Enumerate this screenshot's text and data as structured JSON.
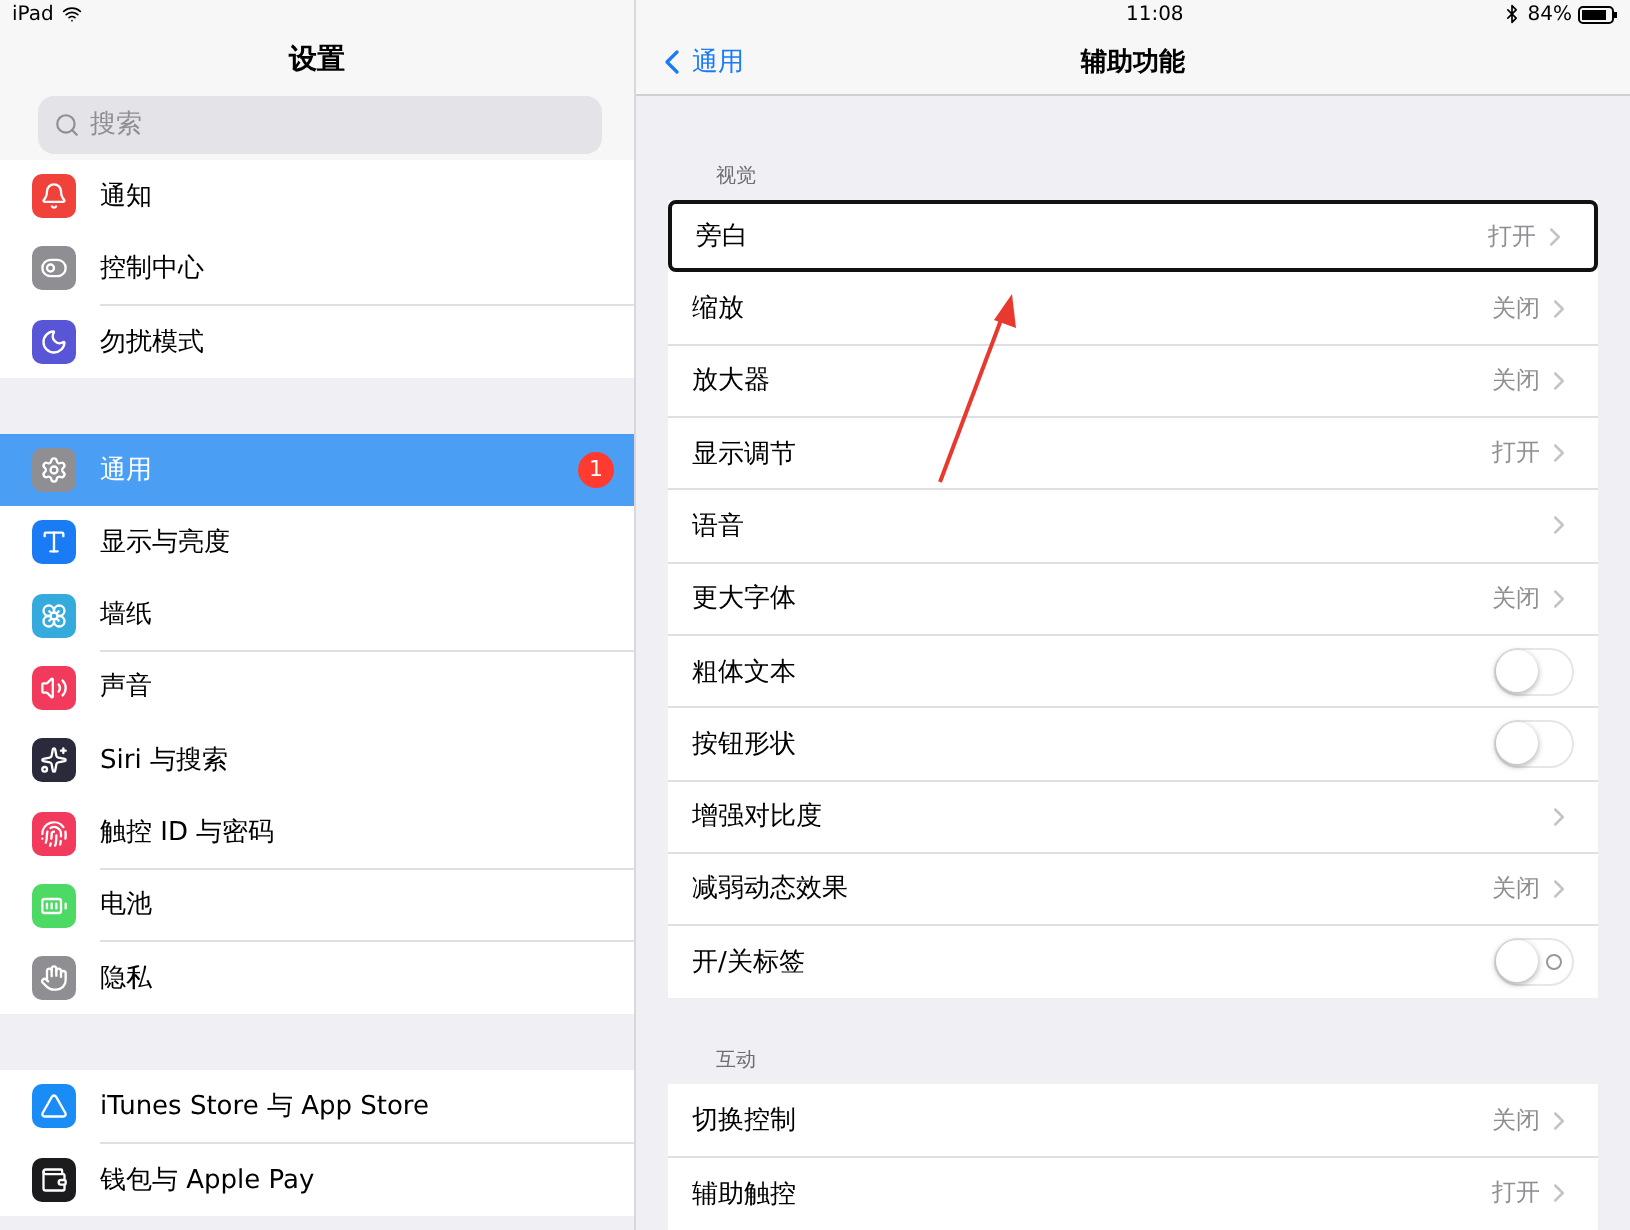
{
  "status_bar": {
    "device": "iPad",
    "time": "11:08",
    "battery": "84%"
  },
  "sidebar": {
    "title": "设置",
    "search": {
      "placeholder": "搜索"
    },
    "groups": [
      {
        "items": [
          {
            "label": "通知",
            "color": "#f0413a",
            "selected": false
          },
          {
            "label": "控制中心",
            "color": "#8e8e93",
            "selected": false
          },
          {
            "label": "勿扰模式",
            "color": "#5856d6",
            "selected": false
          }
        ]
      },
      {
        "items": [
          {
            "label": "通用",
            "color": "#8e8e93",
            "selected": true,
            "badge": "1"
          },
          {
            "label": "显示与亮度",
            "color": "#1a7cf5",
            "selected": false
          },
          {
            "label": "墙纸",
            "color": "#35aadc",
            "selected": false
          },
          {
            "label": "声音",
            "color": "#f23b5c",
            "selected": false
          },
          {
            "label": "Siri 与搜索",
            "color": "#2a2a3c",
            "selected": false
          },
          {
            "label": "触控 ID 与密码",
            "color": "#f23b5c",
            "selected": false
          },
          {
            "label": "电池",
            "color": "#4cd964",
            "selected": false
          },
          {
            "label": "隐私",
            "color": "#8e8e93",
            "selected": false
          }
        ]
      },
      {
        "items": [
          {
            "label": "iTunes Store 与 App Store",
            "color": "#1a8cf5",
            "selected": false
          },
          {
            "label": "钱包与 Apple Pay",
            "color": "#1c1c1e",
            "selected": false
          }
        ]
      }
    ]
  },
  "detail": {
    "back": "通用",
    "title": "辅助功能",
    "sections": [
      {
        "header": "视觉",
        "rows": [
          {
            "kind": "value",
            "label": "旁白",
            "value": "打开",
            "outlined": true
          },
          {
            "kind": "value",
            "label": "缩放",
            "value": "关闭",
            "outlined": false
          },
          {
            "kind": "value",
            "label": "放大器",
            "value": "关闭",
            "outlined": false
          },
          {
            "kind": "value",
            "label": "显示调节",
            "value": "打开",
            "outlined": false
          },
          {
            "kind": "link",
            "label": "语音",
            "outlined": false
          },
          {
            "kind": "value",
            "label": "更大字体",
            "value": "关闭",
            "outlined": false
          },
          {
            "kind": "toggle",
            "label": "粗体文本",
            "on": false,
            "on_off_labels": false,
            "outlined": false
          },
          {
            "kind": "toggle",
            "label": "按钮形状",
            "on": false,
            "on_off_labels": false,
            "outlined": false
          },
          {
            "kind": "link",
            "label": "增强对比度",
            "outlined": false
          },
          {
            "kind": "value",
            "label": "减弱动态效果",
            "value": "关闭",
            "outlined": false
          },
          {
            "kind": "toggle",
            "label": "开/关标签",
            "on": false,
            "on_off_labels": true,
            "outlined": false
          }
        ]
      },
      {
        "header": "互动",
        "rows": [
          {
            "kind": "value",
            "label": "切换控制",
            "value": "关闭",
            "outlined": false
          },
          {
            "kind": "value",
            "label": "辅助触控",
            "value": "打开",
            "outlined": false
          }
        ]
      }
    ]
  }
}
